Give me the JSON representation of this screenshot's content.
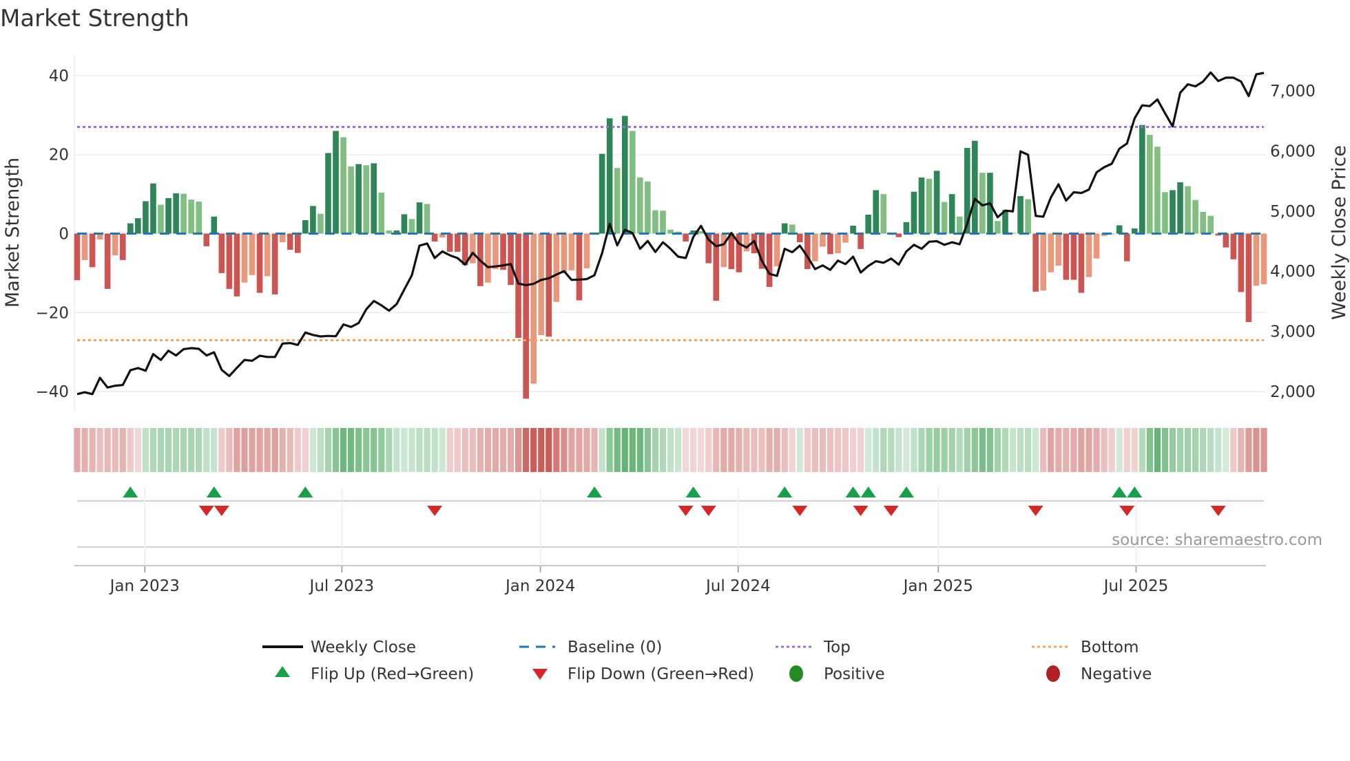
{
  "chart_data": {
    "type": "bar",
    "title": "Market Strength",
    "ylabel": "Market Strength",
    "y2label": "Weekly Close Price",
    "ylim": [
      -45,
      45
    ],
    "y2lim": [
      1650,
      7800
    ],
    "yticks": [
      40,
      20,
      0,
      -20,
      -40
    ],
    "yticklabels": [
      "40",
      "20",
      "0",
      "−20",
      "−40"
    ],
    "y2ticks": [
      7000,
      6000,
      5000,
      4000,
      3000,
      2000
    ],
    "y2ticklabels": [
      "7,000",
      "6,000",
      "5,000",
      "4,000",
      "3,000",
      "2,000"
    ],
    "xticks": [
      {
        "week": 8.9,
        "label": "Jan 2023"
      },
      {
        "week": 34.8,
        "label": "Jul 2023"
      },
      {
        "week": 60.9,
        "label": "Jan 2024"
      },
      {
        "week": 86.9,
        "label": "Jul 2024"
      },
      {
        "week": 113.2,
        "label": "Jan 2025"
      },
      {
        "week": 139.2,
        "label": "Jul 2025"
      }
    ],
    "top_level": 27,
    "bottom_level": -27,
    "baseline": 0,
    "strength": [
      -11.8,
      -6.7,
      -8.5,
      -1.5,
      -14,
      -5.5,
      -6.7,
      2.6,
      3.9,
      8.2,
      12.7,
      7.3,
      9,
      10.2,
      10.1,
      8.6,
      8.1,
      -3.2,
      4.3,
      -10,
      -14,
      -15.9,
      -12.4,
      -10.5,
      -15,
      -10.8,
      -15.4,
      -2.2,
      -4.1,
      -4.9,
      3.4,
      7,
      5,
      20.4,
      26,
      24.4,
      17,
      17.6,
      17.3,
      17.8,
      10.4,
      0.8,
      0.8,
      4.9,
      3.7,
      7.9,
      7.5,
      -2,
      -1,
      -4.6,
      -4.6,
      -8,
      -7.5,
      -13.3,
      -12.4,
      -9,
      -9.2,
      -13,
      -26.4,
      -41.8,
      -38,
      -25.7,
      -26.1,
      -17.3,
      -10,
      -9.3,
      -16.9,
      -8.8,
      0.2,
      20.2,
      29.2,
      16.6,
      29.8,
      26,
      14.2,
      13.2,
      5.9,
      5.8,
      1,
      0.5,
      -2,
      0.8,
      0.6,
      -7.5,
      -17,
      -8.5,
      -9,
      -9.8,
      -4.5,
      -5,
      -8.9,
      -13.5,
      -8.3,
      2.6,
      2.3,
      -2.2,
      -9,
      -7,
      -3.3,
      -5.2,
      -5,
      -2.3,
      2,
      -3.9,
      4.8,
      11,
      10,
      -0.3,
      -0.9,
      2.9,
      10.6,
      14.2,
      13.9,
      15.9,
      8,
      10,
      4.3,
      21.7,
      23.5,
      15.4,
      15.4,
      3.2,
      6,
      0.2,
      9.5,
      8.7,
      -14.7,
      -14.4,
      -9.8,
      -8.1,
      -11.7,
      -11.7,
      -15,
      -11,
      -6.3,
      -0.6,
      -0.2,
      2.1,
      -7,
      1.3,
      27.5,
      25,
      22,
      10.5,
      11,
      13,
      12,
      8.5,
      5.5,
      4.5,
      -0.5,
      -3.5,
      -6.5,
      -14.8,
      -22.4,
      -13.2,
      -12.8
    ],
    "weekly_close": [
      1956,
      1987,
      1956,
      2228,
      2066,
      2096,
      2109,
      2355,
      2390,
      2346,
      2622,
      2525,
      2679,
      2600,
      2705,
      2722,
      2709,
      2600,
      2652,
      2359,
      2258,
      2394,
      2525,
      2512,
      2595,
      2574,
      2574,
      2797,
      2806,
      2775,
      2981,
      2941,
      2915,
      2924,
      2919,
      3116,
      3073,
      3138,
      3366,
      3506,
      3432,
      3344,
      3454,
      3694,
      3935,
      4426,
      4461,
      4220,
      4329,
      4264,
      4220,
      4110,
      4307,
      4176,
      4067,
      4080,
      4097,
      4119,
      3795,
      3769,
      3791,
      3856,
      3883,
      3944,
      4001,
      3856,
      3861,
      3870,
      3935,
      4299,
      4789,
      4430,
      4689,
      4636,
      4373,
      4504,
      4320,
      4482,
      4373,
      4242,
      4220,
      4570,
      4754,
      4526,
      4417,
      4447,
      4636,
      4461,
      4395,
      4504,
      4176,
      3957,
      3922,
      4373,
      4316,
      4426,
      4242,
      4036,
      4097,
      4023,
      4176,
      4119,
      4242,
      3979,
      4088,
      4167,
      4141,
      4211,
      4110,
      4329,
      4439,
      4373,
      4491,
      4500,
      4439,
      4482,
      4447,
      4789,
      5205,
      5095,
      5131,
      4898,
      5008,
      4995,
      5993,
      5936,
      4920,
      4907,
      5227,
      5446,
      5174,
      5314,
      5301,
      5358,
      5643,
      5730,
      5787,
      6037,
      6124,
      6540,
      6759,
      6746,
      6856,
      6628,
      6409,
      6969,
      7109,
      7074,
      7153,
      7306,
      7162,
      7219,
      7219,
      7153,
      6913,
      7276,
      7298
    ],
    "flip_up_weeks": [
      7,
      18,
      30,
      68,
      81,
      93,
      102,
      104,
      109,
      137,
      139
    ],
    "flip_down_weeks": [
      17,
      19,
      47,
      80,
      83,
      95,
      103,
      107,
      126,
      138,
      150
    ],
    "legend": {
      "weekly_close": "Weekly Close",
      "baseline": "Baseline (0)",
      "top": "Top",
      "bottom": "Bottom",
      "flip_up": "Flip Up (Red→Green)",
      "flip_down": "Flip Down (Green→Red)",
      "positive": "Positive",
      "negative": "Negative"
    },
    "legend_placement": "bottom",
    "source": "source: sharemaestro.com",
    "colors": {
      "pos_strong": "#2e8656",
      "pos_weak": "#80bf80",
      "neg_strong": "#cc5552",
      "neg_weak": "#e9987c",
      "baseline": "#1f77b4",
      "top": "#9b6ee0",
      "bottom": "#f2a461",
      "close": "#111111",
      "flip_up": "#16a04a",
      "flip_down": "#d62728",
      "positive": "#228b22",
      "negative": "#b22222"
    }
  }
}
